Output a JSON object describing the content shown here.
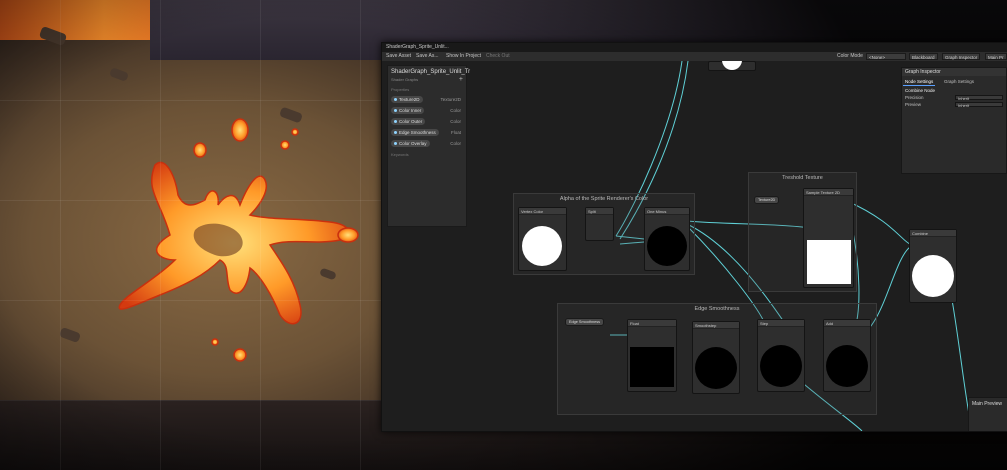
{
  "window": {
    "title": "ShaderGraph_Sprite_Unlit...",
    "toolbar": {
      "save_asset": "Save Asset",
      "save_as": "Save As...",
      "show_in_project": "Show In Project",
      "check_out": "Check Out",
      "color_mode_label": "Color Mode",
      "color_mode_value": "<None>",
      "blackboard": "Blackboard",
      "graph_inspector": "Graph Inspector",
      "main_preview": "Main Pr"
    }
  },
  "blackboard": {
    "title": "ShaderGraph_Sprite_Unlit_Tr",
    "subtitle": "Shader Graphs",
    "category": "Properties",
    "properties": [
      {
        "name": "Texture2D",
        "type": "Texture2D"
      },
      {
        "name": "Color Inner",
        "type": "Color"
      },
      {
        "name": "Color Outer",
        "type": "Color"
      },
      {
        "name": "Edge Smoothness",
        "type": "Float"
      },
      {
        "name": "Color Overlay",
        "type": "Color"
      }
    ],
    "keywords_label": "Keywords"
  },
  "inspector": {
    "title": "Graph Inspector",
    "tabs": [
      "Node Settings",
      "Graph Settings"
    ],
    "active_tab": 0,
    "section": "Combine Node",
    "rows": [
      {
        "label": "Precision",
        "value": "Inherit"
      },
      {
        "label": "Preview",
        "value": "Inherit"
      }
    ]
  },
  "groups": {
    "alpha": "Alpha of the Sprite Renderer's Color",
    "threshold": "Treshold Texture",
    "edge": "Edge Smoothness"
  },
  "nodes": {
    "vertex_color": "Vertex Color",
    "split": "Split",
    "one_minus": "One Minus",
    "sample_texture": "Sample Texture 2D",
    "combine": "Combine",
    "float": "Float",
    "smoothstep": "Smoothstep",
    "edge_property": "Edge Smoothness",
    "step": "Step",
    "add": "Add",
    "texture_property": "Texture2D"
  },
  "main_preview_label": "Main Preview",
  "colors": {
    "wire": "#5fd0d6",
    "lava_orange": "#ff8a1f",
    "lava_core": "#ffd24a"
  }
}
